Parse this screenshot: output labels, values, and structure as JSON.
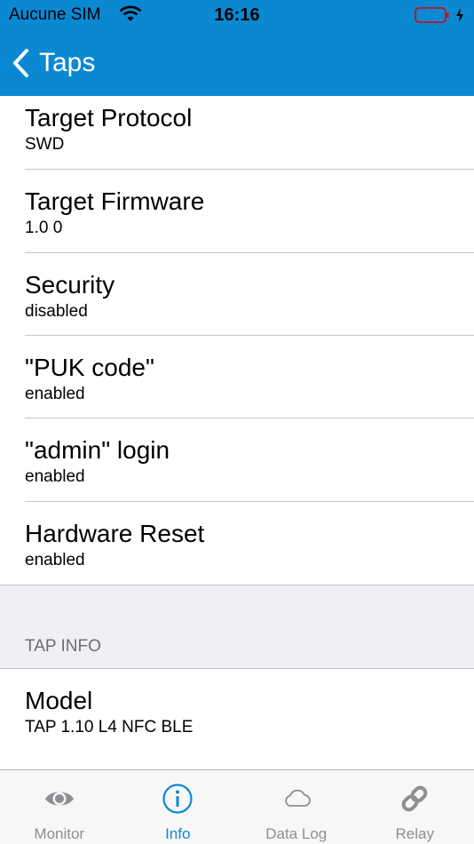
{
  "status": {
    "carrier": "Aucune SIM",
    "time": "16:16"
  },
  "nav": {
    "back_label": "Taps"
  },
  "rows": [
    {
      "title": "Target Protocol",
      "value": "SWD"
    },
    {
      "title": "Target Firmware",
      "value": "1.0 0"
    },
    {
      "title": "Security",
      "value": "disabled"
    },
    {
      "title": "\"PUK code\"",
      "value": "enabled"
    },
    {
      "title": "\"admin\" login",
      "value": "enabled"
    },
    {
      "title": "Hardware Reset",
      "value": "enabled"
    }
  ],
  "section": {
    "header": "TAP INFO"
  },
  "model": {
    "title": "Model",
    "value": "TAP 1.10 L4 NFC BLE"
  },
  "tabs": [
    {
      "label": "Monitor",
      "icon": "eye-icon"
    },
    {
      "label": "Info",
      "icon": "info-icon"
    },
    {
      "label": "Data Log",
      "icon": "cloud-icon"
    },
    {
      "label": "Relay",
      "icon": "link-icon"
    }
  ],
  "colors": {
    "accent": "#0a88d2",
    "tab_inactive": "#8e8e93"
  }
}
